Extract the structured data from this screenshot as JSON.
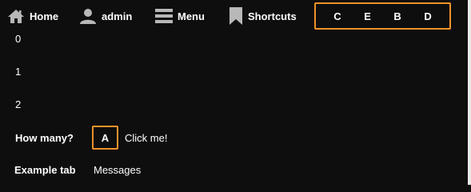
{
  "topbar": {
    "items": [
      {
        "label": "Home",
        "icon": "home-icon"
      },
      {
        "label": "admin",
        "icon": "user-icon"
      },
      {
        "label": "Menu",
        "icon": "menu-icon"
      },
      {
        "label": "Shortcuts",
        "icon": "bookmark-icon"
      }
    ],
    "highlighted": [
      "C",
      "E",
      "B",
      "D"
    ]
  },
  "list": [
    "0",
    "1",
    "2"
  ],
  "form": {
    "label": "How many?",
    "button": "A",
    "link": "Click me!"
  },
  "tabs": {
    "active": "Example tab",
    "other": "Messages"
  },
  "colors": {
    "background": "#0e0e0e",
    "text": "#ffffff",
    "highlight_border": "#f0932a",
    "icon": "#b8b8b8"
  }
}
